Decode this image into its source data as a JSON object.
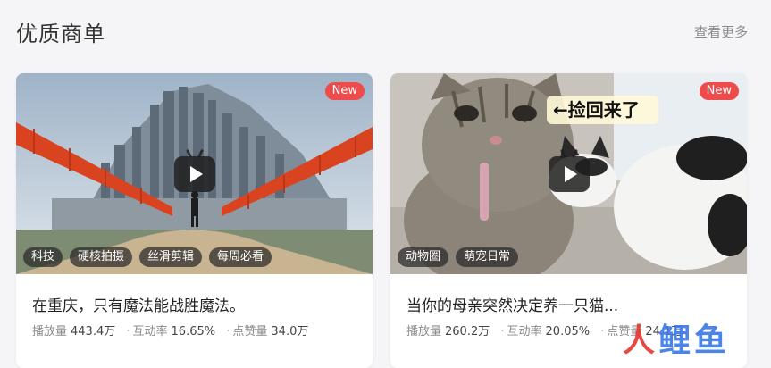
{
  "header": {
    "title": "优质商单",
    "more_label": "查看更多"
  },
  "cards": [
    {
      "badge": "New",
      "tags": [
        "科技",
        "硬核拍摄",
        "丝滑剪辑",
        "每周必看"
      ],
      "title": "在重庆，只有魔法能战胜魔法。",
      "stats": {
        "plays_label": "播放量",
        "plays_value": "443.4万",
        "engagement_label": "互动率",
        "engagement_value": "16.65%",
        "likes_label": "点赞量",
        "likes_value": "34.0万"
      }
    },
    {
      "badge": "New",
      "overlay_caption": "←捡回来了",
      "tags": [
        "动物圈",
        "萌宠日常"
      ],
      "title": "当你的母亲突然决定养一只猫...",
      "stats": {
        "plays_label": "播放量",
        "plays_value": "260.2万",
        "engagement_label": "互动率",
        "engagement_value": "20.05%",
        "likes_label": "点赞量",
        "likes_value": "24.1万"
      }
    }
  ],
  "watermark": {
    "part1": "人",
    "part2": "鲤鱼"
  },
  "colors": {
    "badge": "#ef4b4b",
    "accent_red": "#e53935",
    "accent_blue": "#3d7be6"
  }
}
